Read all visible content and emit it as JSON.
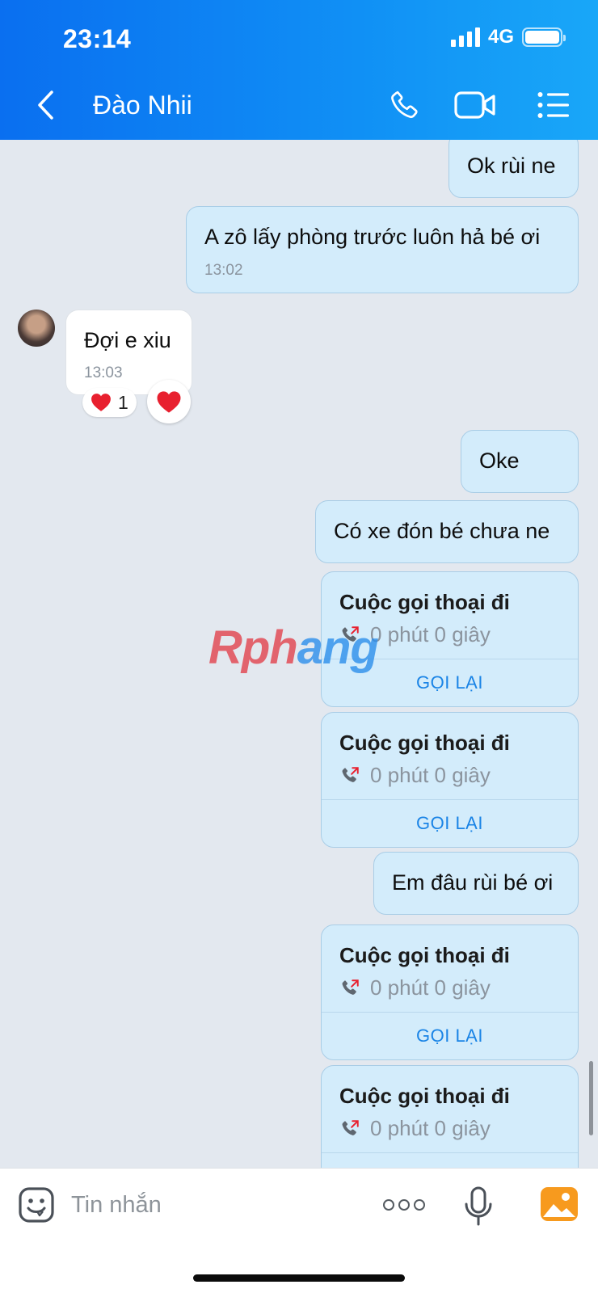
{
  "status_bar": {
    "time": "23:14",
    "network": "4G"
  },
  "header": {
    "contact_name": "Đào Nhii"
  },
  "messages": [
    {
      "text": "Ok rùi ne"
    },
    {
      "text": "A zô lấy phòng trước luôn hả bé ơi",
      "time": "13:02"
    },
    {
      "text": "Đợi e xiu",
      "time": "13:03",
      "reaction_count": "1"
    },
    {
      "text": "Oke"
    },
    {
      "text": "Có xe đón bé chưa ne"
    },
    {
      "text": "Em đâu rùi bé ơi"
    }
  ],
  "call_card": {
    "title": "Cuộc gọi thoại đi",
    "duration": "0 phút 0 giây",
    "redial_label": "GỌI LẠI"
  },
  "watermark": {
    "part1": "Rph",
    "part2": "ang"
  },
  "input": {
    "placeholder": "Tin nhắn"
  },
  "colors": {
    "header_start": "#0a6ff0",
    "header_end": "#19a7f8",
    "outgoing_bubble": "#d3ecfb",
    "link_blue": "#1a84e6",
    "heart": "#e8202f"
  },
  "icons": [
    "back-icon",
    "phone-icon",
    "video-call-icon",
    "menu-list-icon",
    "emoji-icon",
    "more-icon",
    "mic-icon",
    "image-icon",
    "outgoing-call-icon",
    "heart-icon"
  ]
}
